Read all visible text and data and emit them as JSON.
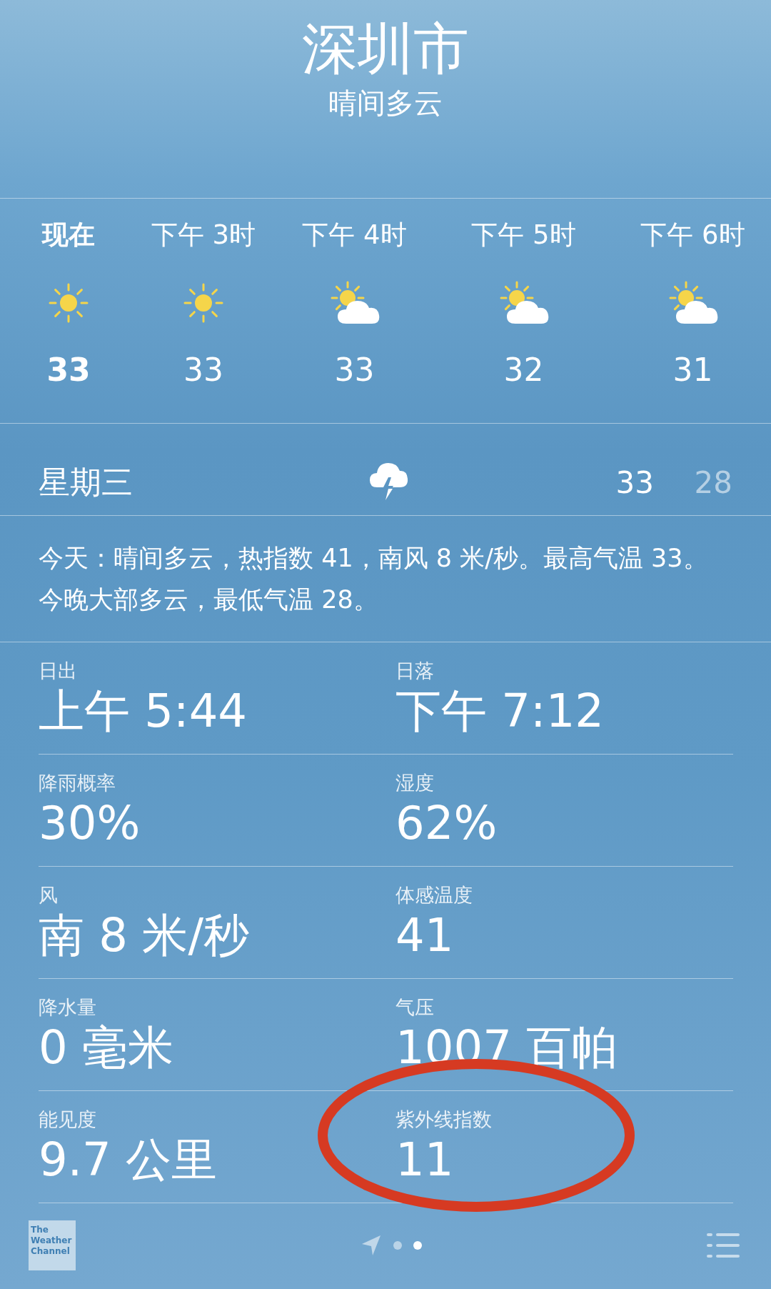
{
  "header": {
    "city": "深圳市",
    "condition": "晴间多云"
  },
  "hourly": [
    {
      "time": "现在",
      "kind": "sun",
      "temp": "33",
      "now": true
    },
    {
      "time": "下午 3时",
      "kind": "sun",
      "temp": "33",
      "now": false
    },
    {
      "time": "下午 4时",
      "kind": "partly_cloudy",
      "temp": "33",
      "now": false
    },
    {
      "time": "下午 5时",
      "kind": "partly_cloudy",
      "temp": "32",
      "now": false
    },
    {
      "time": "下午 6时",
      "kind": "partly_cloudy",
      "temp": "31",
      "now": false
    }
  ],
  "daily": [
    {
      "day": "星期三",
      "kind": "thunderstorm",
      "high": "33",
      "low": "28"
    }
  ],
  "summary": "今天：晴间多云，热指数 41，南风 8 米/秒。最高气温 33。今晚大部多云，最低气温 28。",
  "details": [
    {
      "label": "日出",
      "value": "上午 5:44",
      "highlighted": false
    },
    {
      "label": "日落",
      "value": "下午 7:12",
      "highlighted": false
    },
    {
      "label": "降雨概率",
      "value": "30%",
      "highlighted": false
    },
    {
      "label": "湿度",
      "value": "62%",
      "highlighted": false
    },
    {
      "label": "风",
      "value": "南 8 米/秒",
      "highlighted": false
    },
    {
      "label": "体感温度",
      "value": "41",
      "highlighted": false
    },
    {
      "label": "降水量",
      "value": "0 毫米",
      "highlighted": false
    },
    {
      "label": "气压",
      "value": "1007 百帕",
      "highlighted": false
    },
    {
      "label": "能见度",
      "value": "9.7 公里",
      "highlighted": false
    },
    {
      "label": "紫外线指数",
      "value": "11",
      "highlighted": true
    }
  ],
  "bottom_bar": {
    "logo": "The Weather Channel",
    "pages": [
      {
        "kind": "location",
        "selected": false
      },
      {
        "kind": "dot",
        "selected": false
      },
      {
        "kind": "dot",
        "selected": true
      }
    ]
  }
}
